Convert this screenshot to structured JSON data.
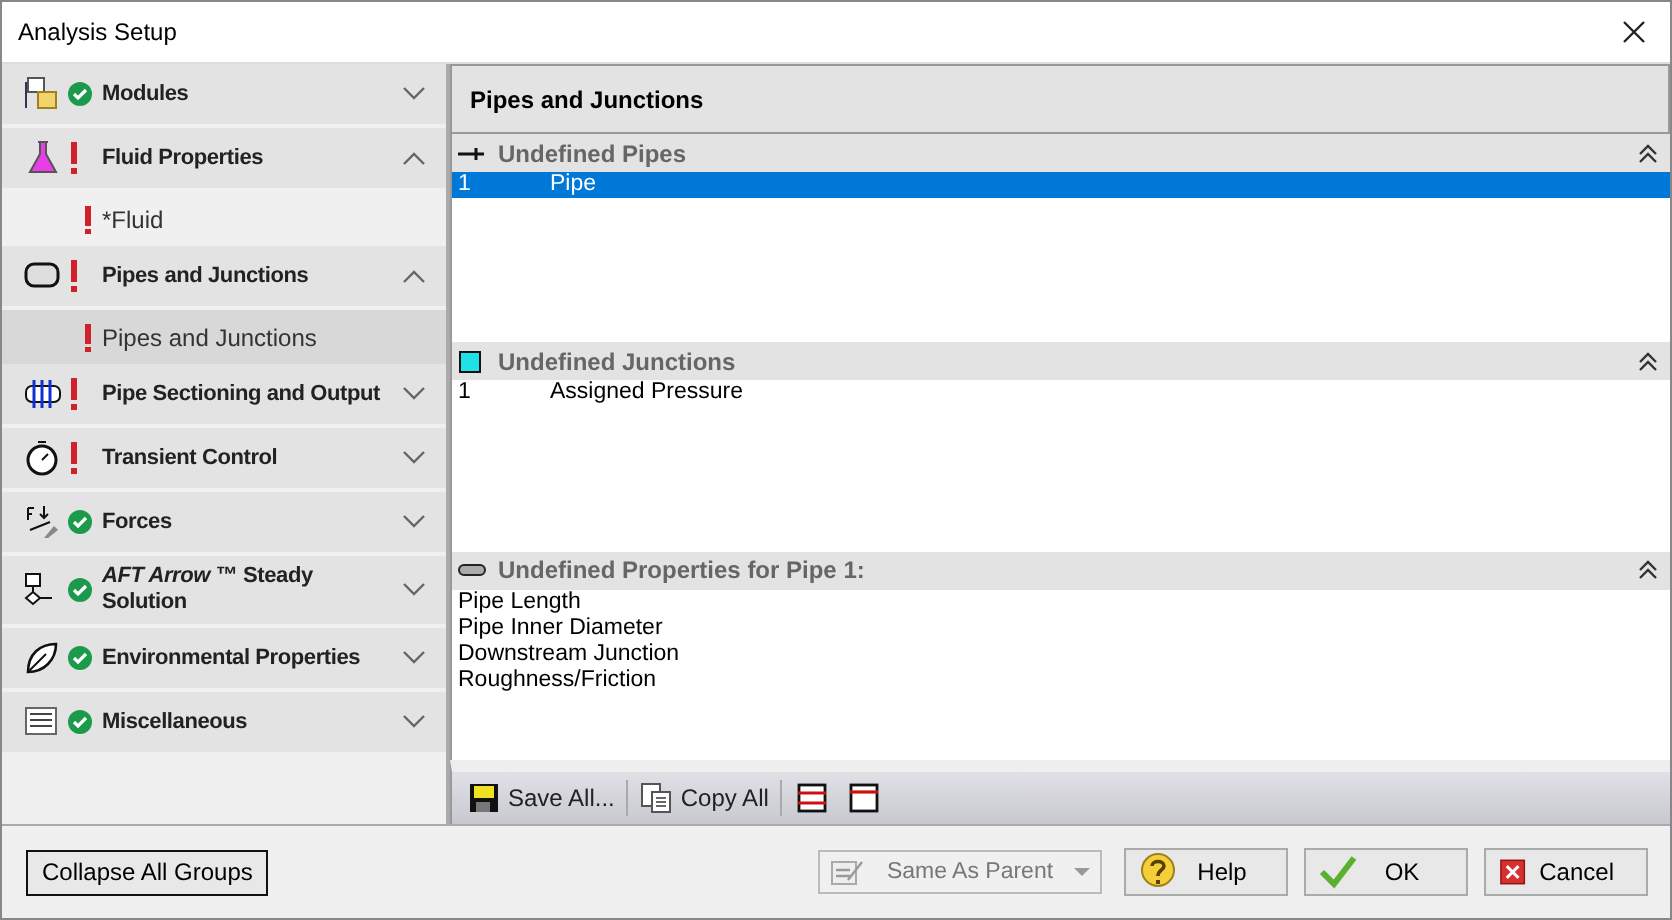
{
  "window": {
    "title": "Analysis Setup"
  },
  "sidebar": {
    "groups": [
      {
        "error": false,
        "title": "Modules",
        "expanded": false
      },
      {
        "error": true,
        "title": "Fluid Properties",
        "expanded": true,
        "children": [
          {
            "label": "*Fluid",
            "error": true,
            "selected": false
          }
        ]
      },
      {
        "error": true,
        "title": "Pipes and Junctions",
        "expanded": true,
        "children": [
          {
            "label": "Pipes and Junctions",
            "error": true,
            "selected": true
          }
        ]
      },
      {
        "error": true,
        "title": "Pipe Sectioning and Output",
        "expanded": false
      },
      {
        "error": true,
        "title": "Transient Control",
        "expanded": false
      },
      {
        "error": false,
        "title": "Forces",
        "expanded": false
      },
      {
        "error": false,
        "title": "*AFT Arrow* ™ Steady Solution",
        "expanded": false
      },
      {
        "error": false,
        "title": "Environmental Properties",
        "expanded": false
      },
      {
        "error": false,
        "title": "Miscellaneous",
        "expanded": false
      }
    ]
  },
  "panel": {
    "title": "Pipes and Junctions",
    "sections": [
      {
        "kind": "table",
        "title": "Undefined Pipes",
        "rows": [
          {
            "number": "1",
            "name": "Pipe",
            "selected": true
          }
        ]
      },
      {
        "kind": "table",
        "title": "Undefined Junctions",
        "rows": [
          {
            "number": "1",
            "name": "Assigned Pressure",
            "selected": false
          }
        ]
      },
      {
        "kind": "list",
        "title": "Undefined Properties for Pipe 1:",
        "lines": [
          "Pipe Length",
          "Pipe Inner Diameter",
          "Downstream Junction",
          "Roughness/Friction"
        ]
      }
    ],
    "toolbar": [
      "Save All...",
      "Copy All"
    ]
  },
  "footer": {
    "collapse_button": "Collapse All Groups",
    "dropdown": {
      "value": "Same As Parent",
      "disabled": true
    },
    "buttons": [
      "Help",
      "OK",
      "Cancel"
    ]
  }
}
